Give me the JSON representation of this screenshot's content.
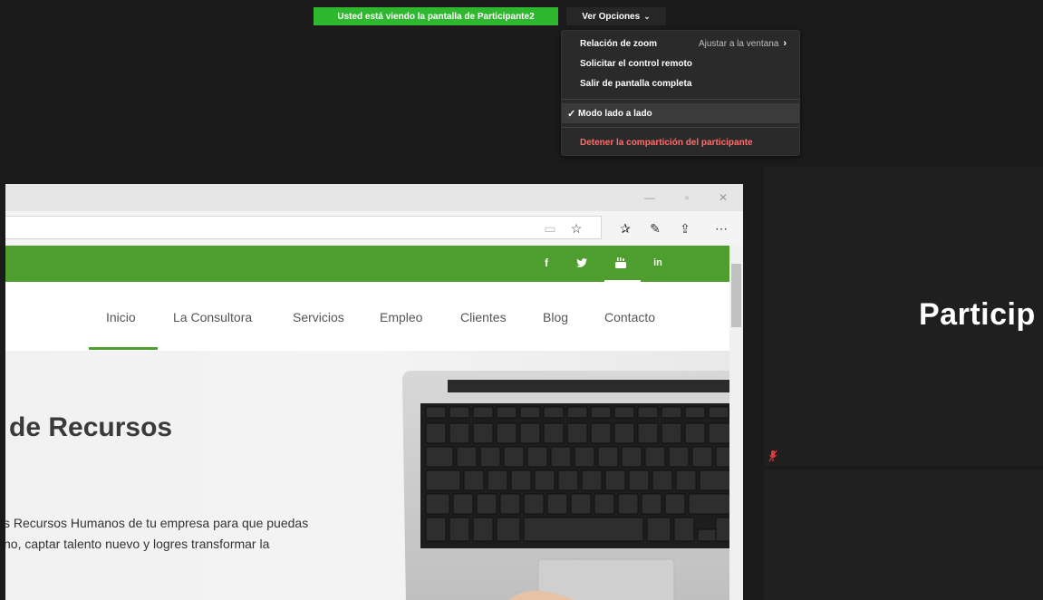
{
  "zoom": {
    "banner_text": "Usted está viendo la pantalla de Participante2",
    "view_options_label": "Ver Opciones",
    "menu": {
      "zoom_ratio_label": "Relación de zoom",
      "zoom_ratio_value": "Ajustar a la ventana",
      "remote_control_label": "Solicitar el control remoto",
      "exit_fullscreen_label": "Salir de pantalla completa",
      "side_by_side_label": "Modo lado a lado",
      "stop_share_label": "Detener la compartición del participante"
    },
    "participant_label": "Particip"
  },
  "browser": {
    "social": [
      "f",
      "y",
      "You",
      "in"
    ]
  },
  "site": {
    "nav": [
      "Inicio",
      "La Consultora",
      "Servicios",
      "Empleo",
      "Clientes",
      "Blog",
      "Contacto"
    ],
    "hero_title": "de Recursos",
    "hero_line1": "s Recursos Humanos de tu empresa para que puedas",
    "hero_line2": "no, captar talento nuevo y logres transformar la"
  },
  "colors": {
    "banner_green": "#2fb82f",
    "site_green": "#4d9e2e",
    "stop_share_red": "#ff6c6c"
  }
}
